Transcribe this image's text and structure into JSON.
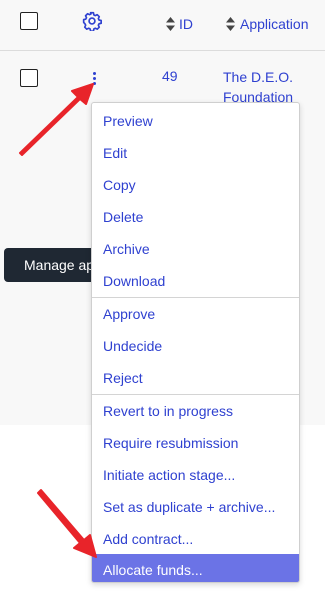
{
  "header": {
    "id_label": "ID",
    "application_label": "Application"
  },
  "row": {
    "id": "49",
    "application_line1": "The D.E.O.",
    "application_line2": "Foundation"
  },
  "manage_button": {
    "label": "Manage appli"
  },
  "menu": {
    "group1": [
      "Preview",
      "Edit",
      "Copy",
      "Delete",
      "Archive",
      "Download"
    ],
    "group2": [
      "Approve",
      "Undecide",
      "Reject"
    ],
    "group3": [
      "Revert to in progress",
      "Require resubmission",
      "Initiate action stage...",
      "Set as duplicate + archive...",
      "Add contract...",
      "Allocate funds..."
    ],
    "active_item": "Allocate funds..."
  },
  "colors": {
    "link": "#2f41d0",
    "highlight": "#6b73e6",
    "button_bg": "#1f2833",
    "arrow": "#e8242a"
  }
}
